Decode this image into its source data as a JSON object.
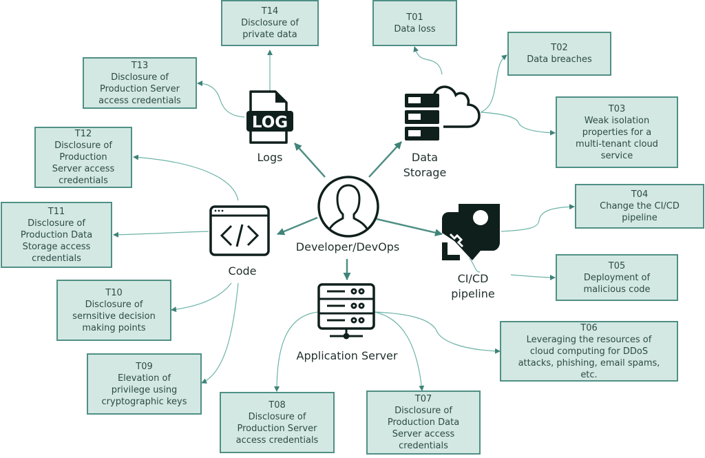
{
  "center": {
    "label": "Developer/DevOps",
    "icon": "user-icon"
  },
  "assets": {
    "logs": {
      "label": "Logs",
      "icon": "log-file-icon"
    },
    "data_storage": {
      "label": "Data\nStorage",
      "icon": "database-cloud-icon"
    },
    "code": {
      "label": "Code",
      "icon": "code-window-icon"
    },
    "cicd": {
      "label": "CI/CD\npipeline",
      "icon": "rocket-icon"
    },
    "app_server": {
      "label": "Application Server",
      "icon": "server-icon"
    }
  },
  "threats": [
    {
      "id": "T01",
      "text": "Data loss",
      "asset": "data_storage"
    },
    {
      "id": "T02",
      "text": "Data breaches",
      "asset": "data_storage"
    },
    {
      "id": "T03",
      "text": "Weak isolation\nproperties for a\nmulti-tenant cloud\nservice",
      "asset": "data_storage"
    },
    {
      "id": "T04",
      "text": "Change the CI/CD\npipeline",
      "asset": "cicd"
    },
    {
      "id": "T05",
      "text": "Deployment of\nmalicious code",
      "asset": "cicd"
    },
    {
      "id": "T06",
      "text": "Leveraging the resources of\ncloud computing for DDoS\nattacks, phishing, email spams,\netc.",
      "asset": "app_server"
    },
    {
      "id": "T07",
      "text": "Disclosure of\nProduction Data\nServer access\ncredentials",
      "asset": "app_server"
    },
    {
      "id": "T08",
      "text": "Disclosure of\nProduction Server\naccess credentials",
      "asset": "app_server"
    },
    {
      "id": "T09",
      "text": "Elevation of\nprivilege using\ncryptographic keys",
      "asset": "code"
    },
    {
      "id": "T10",
      "text": "Disclosure of\nsernsitive decision\nmaking points",
      "asset": "code"
    },
    {
      "id": "T11",
      "text": "Disclosure of\nProduction Data\nStorage access\ncredentials",
      "asset": "code"
    },
    {
      "id": "T12",
      "text": "Disclosure of\nProduction\nServer access\ncredentials",
      "asset": "code"
    },
    {
      "id": "T13",
      "text": "Disclosure of\nProduction Server\naccess credentials",
      "asset": "logs"
    },
    {
      "id": "T14",
      "text": "Disclosure of\nprivate data",
      "asset": "logs"
    }
  ],
  "colors": {
    "box_fill": "#d3e8e3",
    "box_border": "#4f8f84",
    "connector": "#4f9a8e",
    "icon": "#0f1f1c"
  }
}
